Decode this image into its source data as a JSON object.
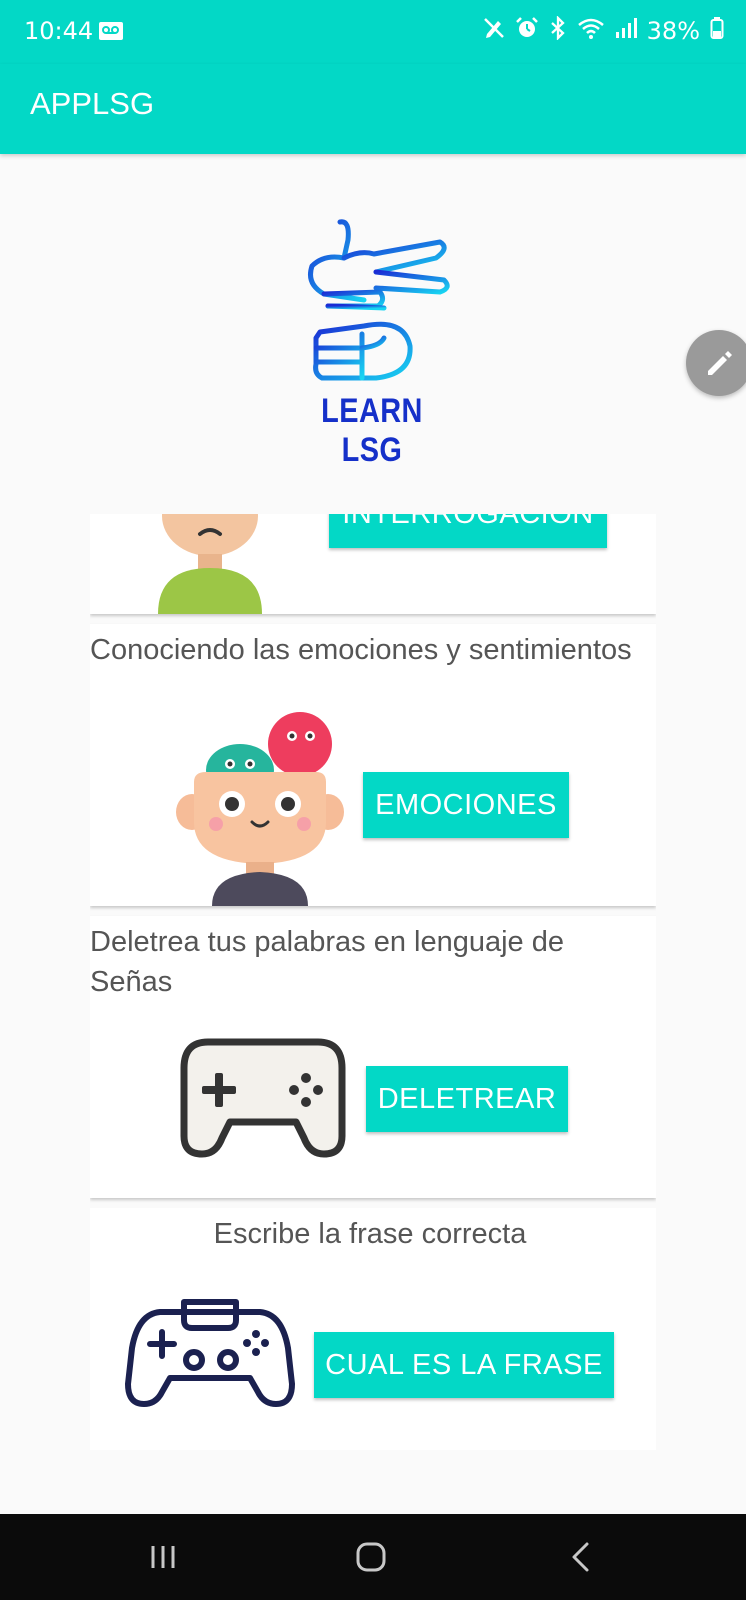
{
  "status_bar": {
    "time": "10:44",
    "battery": "38%",
    "icons": [
      "voicemail-icon",
      "no-pen-icon",
      "alarm-icon",
      "bluetooth-icon",
      "wifi-icon",
      "signal-icon",
      "battery-icon"
    ]
  },
  "app_bar": {
    "title": "APPLSG"
  },
  "logo": {
    "text": "LEARN LSG"
  },
  "fab": {
    "icon": "edit-pencil-icon"
  },
  "cards": [
    {
      "description": "",
      "button": "INTERROGACIÓN",
      "illustration": "sad-child-icon"
    },
    {
      "description": "Conociendo las emociones y sentimientos",
      "button": "EMOCIONES",
      "illustration": "emotions-child-icon"
    },
    {
      "description": "Deletrea tus palabras en lenguaje de Señas",
      "button": "DELETREAR",
      "illustration": "gamepad-icon"
    },
    {
      "description": "Escribe la frase correcta",
      "button": "CUAL ES LA FRASE",
      "illustration": "game-controller-icon"
    }
  ],
  "nav_bar": {
    "recent": "recent-apps-icon",
    "home": "home-icon",
    "back": "back-icon"
  },
  "colors": {
    "accent": "#03d8c6",
    "logo_blue": "#1530c9",
    "navbar": "#0b0b0b"
  }
}
